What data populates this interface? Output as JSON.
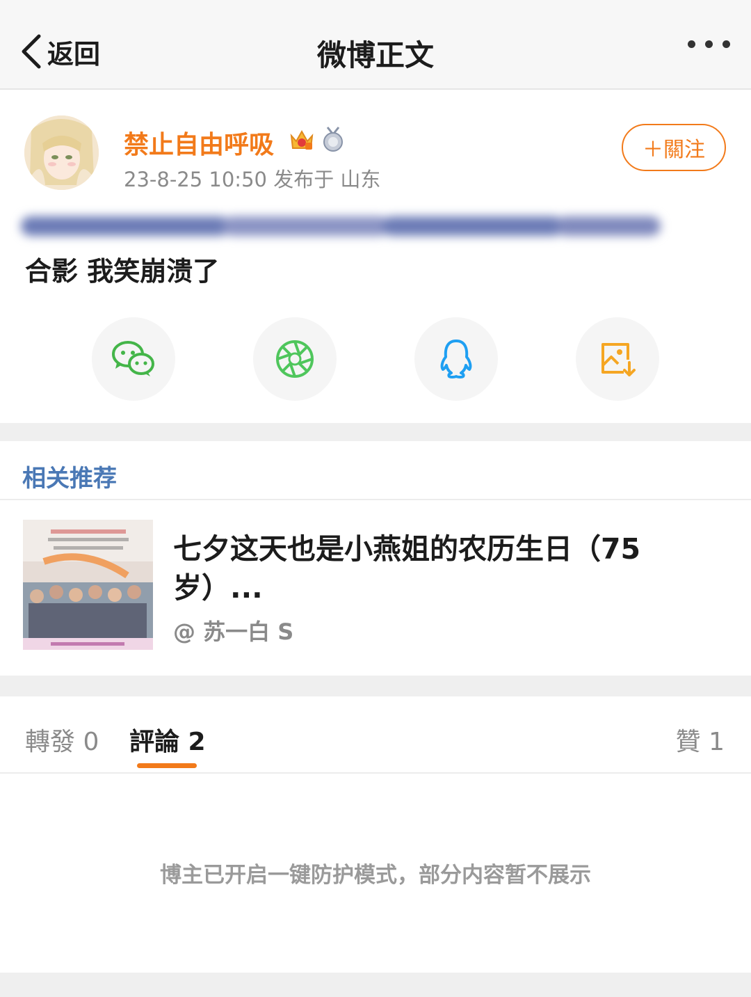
{
  "nav": {
    "back_label": "返回",
    "title": "微博正文",
    "back_icon": "chevron-left-icon",
    "more_icon": "more-dots-icon"
  },
  "post": {
    "username": "禁止自由呼吸",
    "badges": [
      "crown-badge-icon",
      "medal-badge-icon"
    ],
    "meta": "23-8-25 10:50  发布于 山东",
    "follow_label": "＋關注",
    "text": "合影 我笑崩溃了"
  },
  "share": [
    {
      "name": "wechat-icon",
      "color": "#44b549"
    },
    {
      "name": "moments-icon",
      "color": "#4fc65c"
    },
    {
      "name": "qq-icon",
      "color": "#1e9ff2"
    },
    {
      "name": "save-image-icon",
      "color": "#f5a623"
    }
  ],
  "related": {
    "heading": "相关推荐",
    "item": {
      "title": "七夕这天也是小燕姐的农历生日（75岁）...",
      "author": "@ 苏一白 S"
    }
  },
  "tabs": {
    "forward": "轉發 0",
    "comment": "評論 2",
    "like": "贊 1"
  },
  "notice": "博主已开启一键防护模式，部分内容暂不展示",
  "colors": {
    "accent": "#f27a1a",
    "link_blue": "#4a78b5"
  }
}
